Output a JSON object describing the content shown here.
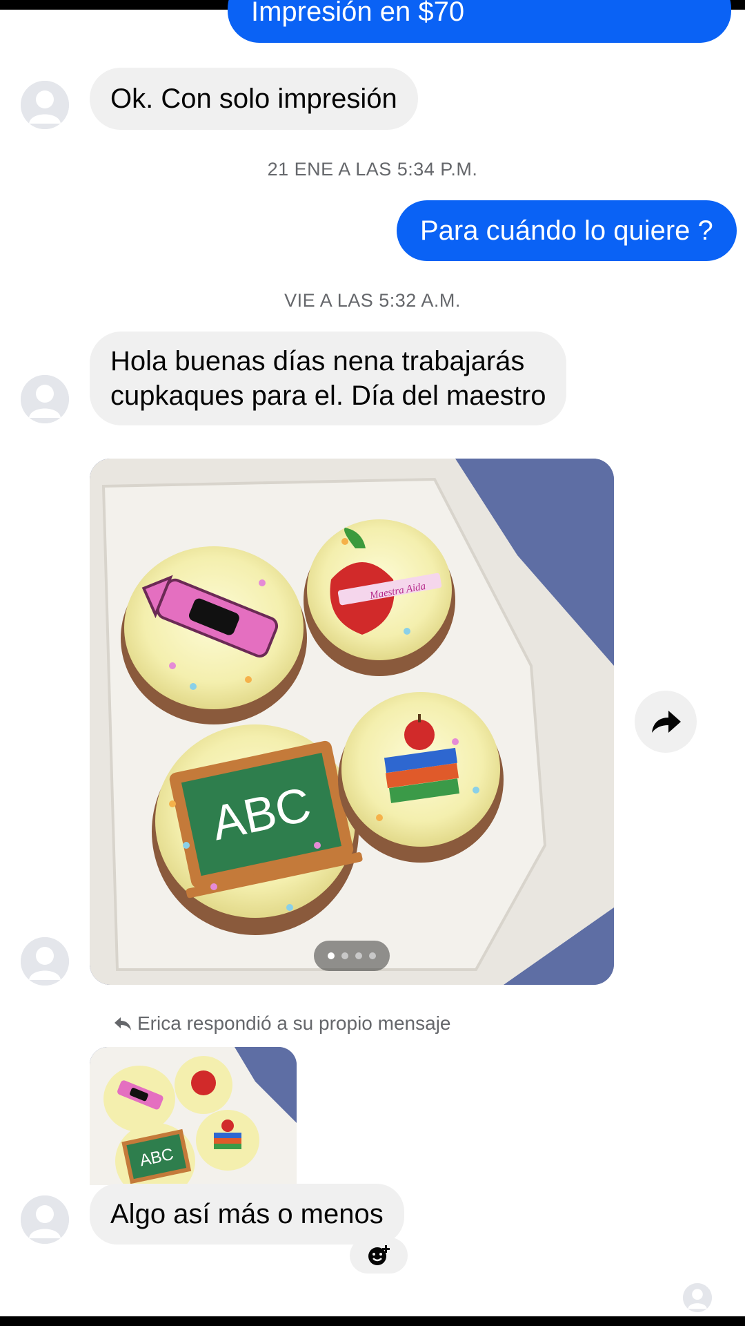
{
  "messages": {
    "top_out": "Impresión en $70",
    "in_1": "Ok. Con solo impresión",
    "ts_1": "21 ENE A LAS 5:34 P.M.",
    "out_2": "Para cuándo lo quiere ?",
    "ts_2": "VIE A LAS 5:32 A.M.",
    "in_2_line1": "Hola buenas días nena trabajarás",
    "in_2_line2": "cupkaques para el. Día del maestro",
    "reply_note": "Erica respondió a su propio mensaje",
    "in_3": "Algo así más o menos"
  },
  "image": {
    "board_text": "ABC",
    "apple_ribbon_text": "Maestra Aida",
    "pager_total": 4,
    "pager_active": 1
  },
  "icons": {
    "avatar": "default-profile-icon",
    "share": "share-forward-icon",
    "reply": "reply-arrow-icon",
    "react": "add-reaction-icon"
  },
  "colors": {
    "outgoing_bubble": "#0a62f5",
    "incoming_bubble": "#f0f0f0",
    "meta_text": "#65676b"
  }
}
